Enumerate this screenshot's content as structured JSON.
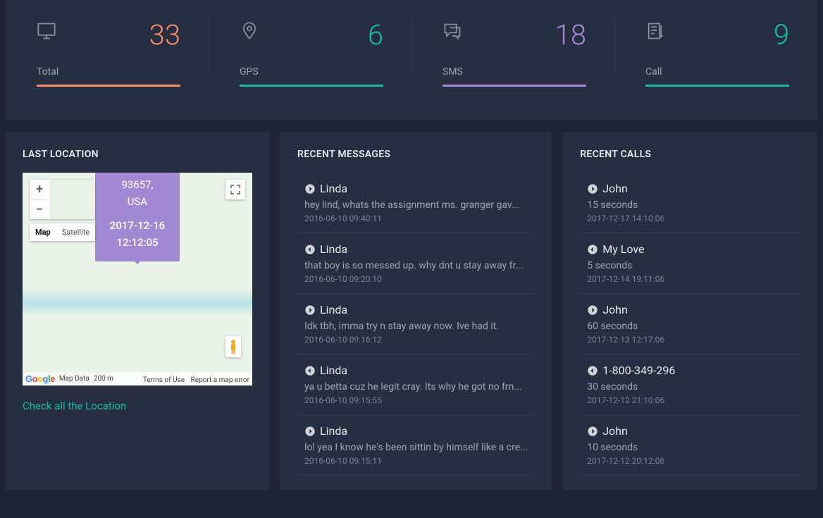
{
  "stats": {
    "total": {
      "label": "Total",
      "value": "33",
      "color": "#f98c6b"
    },
    "gps": {
      "label": "GPS",
      "value": "6",
      "color": "#1abc9c"
    },
    "sms": {
      "label": "SMS",
      "value": "18",
      "color": "#a389d4"
    },
    "call": {
      "label": "Call",
      "value": "9",
      "color": "#1abc9c"
    }
  },
  "lastLocation": {
    "title": "LAST LOCATION",
    "bubble": {
      "l1": "93657,",
      "l2": "USA",
      "l3": "2017-12-16",
      "l4": "12:12:05"
    },
    "mapType": {
      "map": "Map",
      "satellite": "Satellite"
    },
    "attrib": {
      "mapData": "Map Data",
      "scale": "200 m",
      "terms": "Terms of Use",
      "report": "Report a map error"
    },
    "link": "Check all the Location"
  },
  "messages": {
    "title": "RECENT MESSAGES",
    "items": [
      {
        "dir": "right",
        "name": "Linda",
        "body": "hey lind, whats the assignment ms. granger gav...",
        "time": "2016-06-10 09:40:11"
      },
      {
        "dir": "left",
        "name": "Linda",
        "body": "that boy is so messed up. why dnt u stay away fr...",
        "time": "2016-06-10 09:20:10"
      },
      {
        "dir": "right",
        "name": "Linda",
        "body": "Idk tbh, imma try n stay away now. Ive had it.",
        "time": "2016-06-10 09:16:12"
      },
      {
        "dir": "left",
        "name": "Linda",
        "body": "ya u betta cuz he legit cray. Its why he got no frn...",
        "time": "2016-06-10 09:15:55"
      },
      {
        "dir": "right",
        "name": "Linda",
        "body": "lol yea I know he's been sittin by himself like a cre...",
        "time": "2016-06-10 09:15:11"
      }
    ]
  },
  "calls": {
    "title": "RECENT CALLS",
    "items": [
      {
        "dir": "right",
        "name": "John",
        "body": "15 seconds",
        "time": "2017-12-17 14:10:06"
      },
      {
        "dir": "left",
        "name": "My Love",
        "body": "5 seconds",
        "time": "2017-12-14 19:11:06"
      },
      {
        "dir": "right",
        "name": "John",
        "body": "60 seconds",
        "time": "2017-12-13 12:17:06"
      },
      {
        "dir": "left",
        "name": "1-800-349-296",
        "body": "30 seconds",
        "time": "2017-12-12 21:10:06"
      },
      {
        "dir": "right",
        "name": "John",
        "body": "10 seconds",
        "time": "2017-12-12 20:12:06"
      }
    ]
  }
}
